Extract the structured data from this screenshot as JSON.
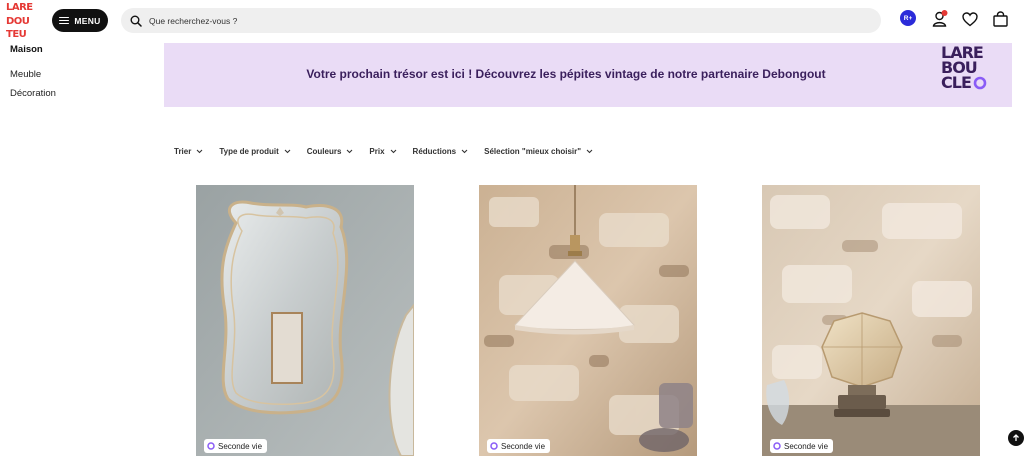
{
  "header": {
    "logo_lines": [
      "LARE",
      "DOU",
      "TEU"
    ],
    "menu_label": "MENU",
    "search_placeholder": "Que recherchez-vous ?",
    "rplus_label": "R+"
  },
  "sidebar": {
    "title": "Maison",
    "items": [
      {
        "label": "Meuble"
      },
      {
        "label": "Décoration"
      }
    ]
  },
  "banner": {
    "text": "Votre prochain trésor est ici ! Découvrez les pépites vintage de notre partenaire Debongout",
    "logo_lines": [
      "LARE",
      "BOU",
      "CLE"
    ],
    "background": "#eadcf6"
  },
  "filters": [
    {
      "label": "Trier"
    },
    {
      "label": "Type de produit"
    },
    {
      "label": "Couleurs"
    },
    {
      "label": "Prix"
    },
    {
      "label": "Réductions"
    },
    {
      "label": "Sélection \"mieux choisir\""
    }
  ],
  "products": [
    {
      "badge": "Seconde vie",
      "image": "vintage-mirror"
    },
    {
      "badge": "Seconde vie",
      "image": "pendant-lamp"
    },
    {
      "badge": "Seconde vie",
      "image": "glass-table-lamp"
    }
  ],
  "colors": {
    "brand_red": "#e53935",
    "accent_purple": "#3a1f5c",
    "badge_icon": "#8a5cf6"
  }
}
